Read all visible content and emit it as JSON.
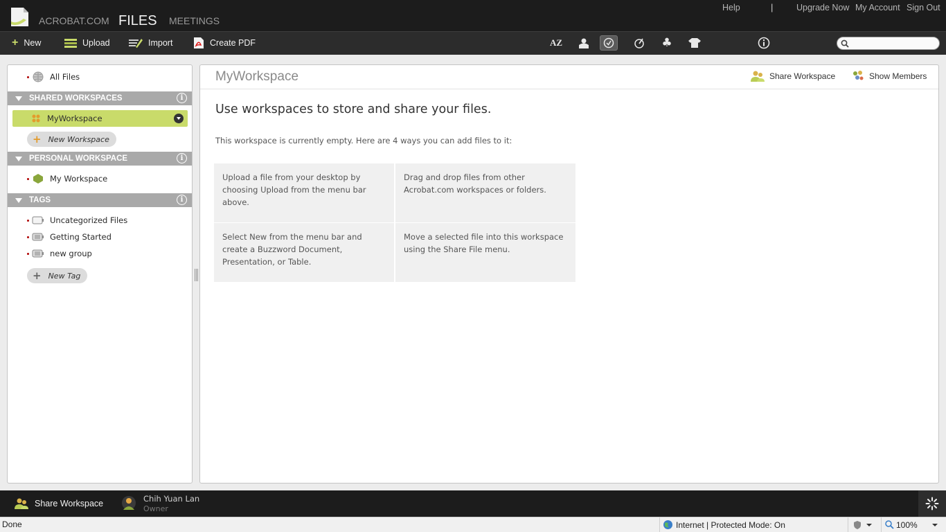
{
  "header": {
    "brand": "ACROBAT.COM",
    "nav": [
      "FILES",
      "MEETINGS"
    ],
    "links": [
      "Help",
      "Upgrade Now",
      "My Account",
      "Sign Out"
    ],
    "separator": "|"
  },
  "toolbar": {
    "new_label": "New",
    "upload_label": "Upload",
    "import_label": "Import",
    "create_pdf_label": "Create PDF",
    "sort_label": "AZ",
    "search": {
      "value": "",
      "placeholder": ""
    }
  },
  "sidebar": {
    "all_files": "All Files",
    "shared_header": "SHARED WORKSPACES",
    "shared_items": [
      "MyWorkspace"
    ],
    "new_workspace": "New Workspace",
    "personal_header": "PERSONAL WORKSPACE",
    "personal_items": [
      "My Workspace"
    ],
    "tags_header": "TAGS",
    "tags": [
      "Uncategorized Files",
      "Getting Started",
      "new group"
    ],
    "new_tag": "New Tag",
    "info_glyph": "i"
  },
  "main": {
    "title": "MyWorkspace",
    "share_workspace": "Share Workspace",
    "show_members": "Show Members",
    "headline": "Use workspaces to store and share your files.",
    "subtext": "This workspace is currently empty.  Here are 4 ways you can add files to it:",
    "ways": [
      "Upload a file from your desktop by choosing Upload from the menu bar above.",
      "Drag and drop files from other Acrobat.com workspaces or folders.",
      "Select New from the menu bar and create a Buzzword Document, Presentation, or Table.",
      "Move a selected file into this workspace using the Share File menu."
    ]
  },
  "bottombar": {
    "share_label": "Share Workspace",
    "user_name": "Chih Yuan Lan",
    "user_role": "Owner"
  },
  "statusbar": {
    "status": "Done",
    "zone": "Internet | Protected Mode: On",
    "zoom": "100%"
  },
  "colors": {
    "accent_green": "#c9db6a",
    "header_bg": "#1c1c1c",
    "section_header": "#a9a9a9"
  }
}
